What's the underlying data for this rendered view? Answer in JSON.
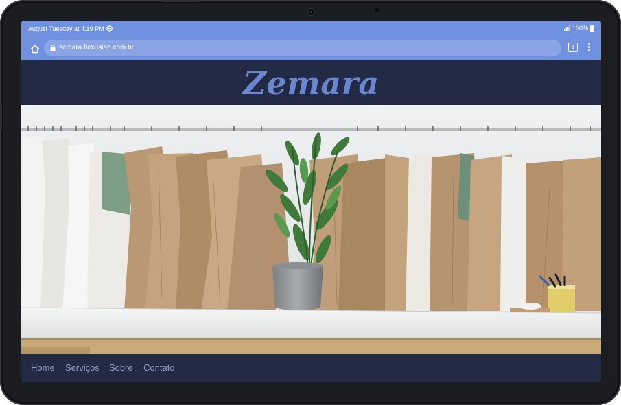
{
  "status_bar": {
    "time_text": "August Tuesday at 4:19 PM",
    "battery": "100%",
    "icons": [
      "notification-icon",
      "signal-icon",
      "battery-icon"
    ]
  },
  "browser": {
    "url": "zemara.flexuslab.com.br",
    "tab_count": "1",
    "icons": [
      "home-icon",
      "lock-icon",
      "tab-switcher-icon",
      "more-vert-icon"
    ]
  },
  "site": {
    "logo": "Zemara",
    "hero_image": "atelier-garment-patterns-with-potted-plant",
    "nav": [
      {
        "label": "Home"
      },
      {
        "label": "Serviços"
      },
      {
        "label": "Sobre"
      },
      {
        "label": "Contato"
      }
    ]
  },
  "colors": {
    "status_bar": "#7091df",
    "header_bg": "#222a45",
    "logo": "#6b86cf",
    "nav_text": "#8f9bbd"
  }
}
